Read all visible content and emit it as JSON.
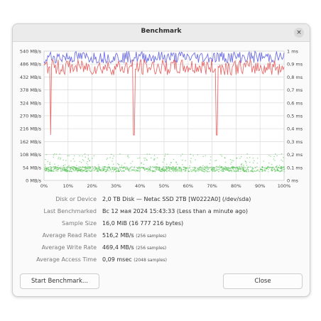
{
  "window": {
    "title": "Benchmark",
    "close_glyph": "×"
  },
  "chart_data": {
    "type": "line",
    "x_ticks": [
      "0%",
      "10%",
      "20%",
      "30%",
      "40%",
      "50%",
      "60%",
      "70%",
      "80%",
      "90%",
      "100%"
    ],
    "y_left_ticks": [
      "0 MB/s",
      "54 MB/s",
      "108 MB/s",
      "162 MB/s",
      "216 MB/s",
      "270 MB/s",
      "324 MB/s",
      "378 MB/s",
      "432 MB/s",
      "486 MB/s",
      "540 MB/s"
    ],
    "y_right_ticks": [
      "0 ms",
      "0,1 ms",
      "0,2 ms",
      "0,3 ms",
      "0,4 ms",
      "0,5 ms",
      "0,6 ms",
      "0,7 ms",
      "0,8 ms",
      "0,9 ms",
      "1 ms"
    ],
    "xlim": [
      0,
      100
    ],
    "ylim_left": [
      0,
      540
    ],
    "ylim_right": [
      0,
      1
    ],
    "grid": true,
    "series": [
      {
        "kind": "read",
        "color": "#6e6ee6",
        "axis": "left",
        "typical": 512,
        "range": [
          490,
          540
        ]
      },
      {
        "kind": "write",
        "color": "#e86a6a",
        "axis": "left",
        "typical": 470,
        "range": [
          440,
          505
        ],
        "dips": [
          {
            "x": 2.7,
            "y": 190
          },
          {
            "x": 37.4,
            "y": 190
          },
          {
            "x": 72.0,
            "y": 190
          }
        ]
      },
      {
        "kind": "access",
        "color": "#3aba3a",
        "axis": "right",
        "style": "scatter",
        "typical": 0.09,
        "range": [
          0.07,
          0.21
        ]
      }
    ]
  },
  "info": [
    {
      "label": "Disk or Device",
      "value": "2,0 TB Disk — Netac SSD 2TB [W0222A0] (/dev/sda)",
      "sub": ""
    },
    {
      "label": "Last Benchmarked",
      "value": "Вс 12 мая 2024 15:43:33 (Less than a minute ago)",
      "sub": ""
    },
    {
      "label": "Sample Size",
      "value": "16,0 MiB (16 777 216 bytes)",
      "sub": ""
    },
    {
      "label": "Average Read Rate",
      "value": "516,2 MB/s",
      "sub": "(256 samples)"
    },
    {
      "label": "Average Write Rate",
      "value": "469,4 MB/s",
      "sub": "(256 samples)"
    },
    {
      "label": "Average Access Time",
      "value": "0,09 msec",
      "sub": "(2048 samples)"
    }
  ],
  "buttons": {
    "start": "Start Benchmark...",
    "close": "Close"
  }
}
